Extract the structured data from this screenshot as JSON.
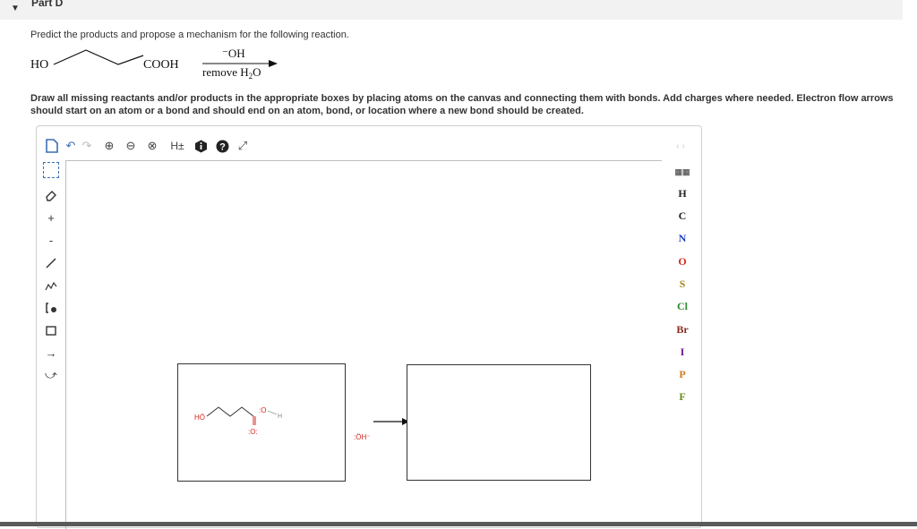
{
  "part": {
    "title": "Part D"
  },
  "prompt": "Predict the products and propose a mechanism for the following reaction.",
  "reaction": {
    "left_group": "HO",
    "right_group": "COOH",
    "reagent_top": "⁻OH",
    "reagent_bottom_prefix": "remove H",
    "reagent_bottom_sub": "2",
    "reagent_bottom_suffix": "O"
  },
  "instructions": "Draw all missing reactants and/or products in the appropriate boxes by placing atoms on the canvas and connecting them with bonds. Add charges where needed. Electron flow arrows should start on an atom or a bond and should end on an atom, bond, or location where a new bond should be created.",
  "toolbar": {
    "hplus_label": "H±",
    "nav_arrows": "‹ ›"
  },
  "left_tools": {
    "plus_label": "+",
    "minus_label": "-"
  },
  "atoms": [
    {
      "symbol": "H",
      "color": "#111111"
    },
    {
      "symbol": "C",
      "color": "#111111"
    },
    {
      "symbol": "N",
      "color": "#1f3fbf"
    },
    {
      "symbol": "O",
      "color": "#d42a1d"
    },
    {
      "symbol": "S",
      "color": "#a8861a"
    },
    {
      "symbol": "Cl",
      "color": "#2d8a2d"
    },
    {
      "symbol": "Br",
      "color": "#8a2a1a"
    },
    {
      "symbol": "I",
      "color": "#6a1a9a"
    },
    {
      "symbol": "P",
      "color": "#d27a1a"
    },
    {
      "symbol": "F",
      "color": "#6a8a1a"
    }
  ],
  "molecule_labels": {
    "ho": "HÖ",
    "o_top": ":O",
    "h": "H",
    "o_bottom": ":O:",
    "hydroxide": ":ÖH⁻"
  },
  "colors": {
    "oxygen": "#d42a1d",
    "atom_gray": "#888888"
  }
}
